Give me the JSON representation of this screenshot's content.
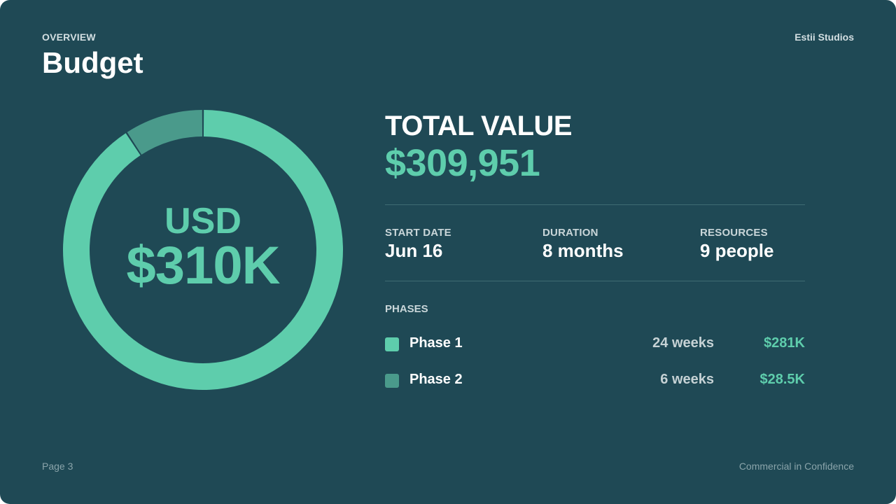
{
  "header": {
    "overline": "OVERVIEW",
    "title": "Budget",
    "brand": "Estii Studios"
  },
  "donut": {
    "center_top": "USD",
    "center_value": "$310K"
  },
  "summary": {
    "total_label": "TOTAL VALUE",
    "total_value": "$309,951",
    "stats": [
      {
        "label": "START DATE",
        "value": "Jun 16"
      },
      {
        "label": "DURATION",
        "value": "8 months"
      },
      {
        "label": "RESOURCES",
        "value": "9 people"
      }
    ],
    "phases_label": "PHASES"
  },
  "footer": {
    "page": "Page 3",
    "confidentiality": "Commercial in Confidence"
  },
  "colors": {
    "background": "#1f4955",
    "accent": "#5ecdac",
    "phase_1": "#5ecdac",
    "phase_2": "#4a9a8b"
  },
  "chart_data": {
    "type": "pie",
    "style": "donut",
    "categories": [
      "Phase 1",
      "Phase 2"
    ],
    "values": [
      281000,
      28500
    ],
    "series": [
      {
        "name": "Phase 1",
        "weeks": "24 weeks",
        "amount": "$281K",
        "value": 281000,
        "color": "#5ecdac"
      },
      {
        "name": "Phase 2",
        "weeks": "6 weeks",
        "amount": "$28.5K",
        "value": 28500,
        "color": "#4a9a8b"
      }
    ],
    "title": "",
    "legend": "right"
  }
}
